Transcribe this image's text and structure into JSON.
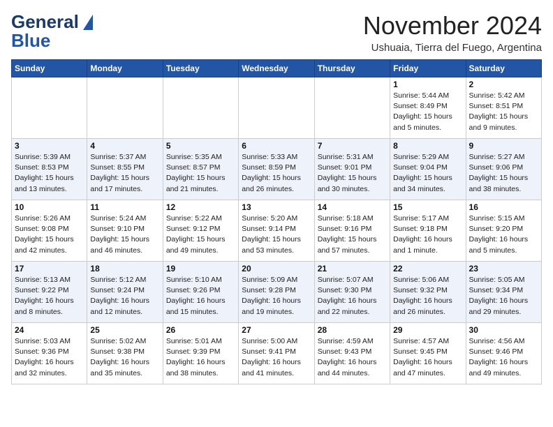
{
  "header": {
    "logo_line1": "General",
    "logo_line2": "Blue",
    "month_title": "November 2024",
    "subtitle": "Ushuaia, Tierra del Fuego, Argentina"
  },
  "weekdays": [
    "Sunday",
    "Monday",
    "Tuesday",
    "Wednesday",
    "Thursday",
    "Friday",
    "Saturday"
  ],
  "weeks": [
    [
      {
        "day": "",
        "info": ""
      },
      {
        "day": "",
        "info": ""
      },
      {
        "day": "",
        "info": ""
      },
      {
        "day": "",
        "info": ""
      },
      {
        "day": "",
        "info": ""
      },
      {
        "day": "1",
        "info": "Sunrise: 5:44 AM\nSunset: 8:49 PM\nDaylight: 15 hours\nand 5 minutes."
      },
      {
        "day": "2",
        "info": "Sunrise: 5:42 AM\nSunset: 8:51 PM\nDaylight: 15 hours\nand 9 minutes."
      }
    ],
    [
      {
        "day": "3",
        "info": "Sunrise: 5:39 AM\nSunset: 8:53 PM\nDaylight: 15 hours\nand 13 minutes."
      },
      {
        "day": "4",
        "info": "Sunrise: 5:37 AM\nSunset: 8:55 PM\nDaylight: 15 hours\nand 17 minutes."
      },
      {
        "day": "5",
        "info": "Sunrise: 5:35 AM\nSunset: 8:57 PM\nDaylight: 15 hours\nand 21 minutes."
      },
      {
        "day": "6",
        "info": "Sunrise: 5:33 AM\nSunset: 8:59 PM\nDaylight: 15 hours\nand 26 minutes."
      },
      {
        "day": "7",
        "info": "Sunrise: 5:31 AM\nSunset: 9:01 PM\nDaylight: 15 hours\nand 30 minutes."
      },
      {
        "day": "8",
        "info": "Sunrise: 5:29 AM\nSunset: 9:04 PM\nDaylight: 15 hours\nand 34 minutes."
      },
      {
        "day": "9",
        "info": "Sunrise: 5:27 AM\nSunset: 9:06 PM\nDaylight: 15 hours\nand 38 minutes."
      }
    ],
    [
      {
        "day": "10",
        "info": "Sunrise: 5:26 AM\nSunset: 9:08 PM\nDaylight: 15 hours\nand 42 minutes."
      },
      {
        "day": "11",
        "info": "Sunrise: 5:24 AM\nSunset: 9:10 PM\nDaylight: 15 hours\nand 46 minutes."
      },
      {
        "day": "12",
        "info": "Sunrise: 5:22 AM\nSunset: 9:12 PM\nDaylight: 15 hours\nand 49 minutes."
      },
      {
        "day": "13",
        "info": "Sunrise: 5:20 AM\nSunset: 9:14 PM\nDaylight: 15 hours\nand 53 minutes."
      },
      {
        "day": "14",
        "info": "Sunrise: 5:18 AM\nSunset: 9:16 PM\nDaylight: 15 hours\nand 57 minutes."
      },
      {
        "day": "15",
        "info": "Sunrise: 5:17 AM\nSunset: 9:18 PM\nDaylight: 16 hours\nand 1 minute."
      },
      {
        "day": "16",
        "info": "Sunrise: 5:15 AM\nSunset: 9:20 PM\nDaylight: 16 hours\nand 5 minutes."
      }
    ],
    [
      {
        "day": "17",
        "info": "Sunrise: 5:13 AM\nSunset: 9:22 PM\nDaylight: 16 hours\nand 8 minutes."
      },
      {
        "day": "18",
        "info": "Sunrise: 5:12 AM\nSunset: 9:24 PM\nDaylight: 16 hours\nand 12 minutes."
      },
      {
        "day": "19",
        "info": "Sunrise: 5:10 AM\nSunset: 9:26 PM\nDaylight: 16 hours\nand 15 minutes."
      },
      {
        "day": "20",
        "info": "Sunrise: 5:09 AM\nSunset: 9:28 PM\nDaylight: 16 hours\nand 19 minutes."
      },
      {
        "day": "21",
        "info": "Sunrise: 5:07 AM\nSunset: 9:30 PM\nDaylight: 16 hours\nand 22 minutes."
      },
      {
        "day": "22",
        "info": "Sunrise: 5:06 AM\nSunset: 9:32 PM\nDaylight: 16 hours\nand 26 minutes."
      },
      {
        "day": "23",
        "info": "Sunrise: 5:05 AM\nSunset: 9:34 PM\nDaylight: 16 hours\nand 29 minutes."
      }
    ],
    [
      {
        "day": "24",
        "info": "Sunrise: 5:03 AM\nSunset: 9:36 PM\nDaylight: 16 hours\nand 32 minutes."
      },
      {
        "day": "25",
        "info": "Sunrise: 5:02 AM\nSunset: 9:38 PM\nDaylight: 16 hours\nand 35 minutes."
      },
      {
        "day": "26",
        "info": "Sunrise: 5:01 AM\nSunset: 9:39 PM\nDaylight: 16 hours\nand 38 minutes."
      },
      {
        "day": "27",
        "info": "Sunrise: 5:00 AM\nSunset: 9:41 PM\nDaylight: 16 hours\nand 41 minutes."
      },
      {
        "day": "28",
        "info": "Sunrise: 4:59 AM\nSunset: 9:43 PM\nDaylight: 16 hours\nand 44 minutes."
      },
      {
        "day": "29",
        "info": "Sunrise: 4:57 AM\nSunset: 9:45 PM\nDaylight: 16 hours\nand 47 minutes."
      },
      {
        "day": "30",
        "info": "Sunrise: 4:56 AM\nSunset: 9:46 PM\nDaylight: 16 hours\nand 49 minutes."
      }
    ]
  ]
}
